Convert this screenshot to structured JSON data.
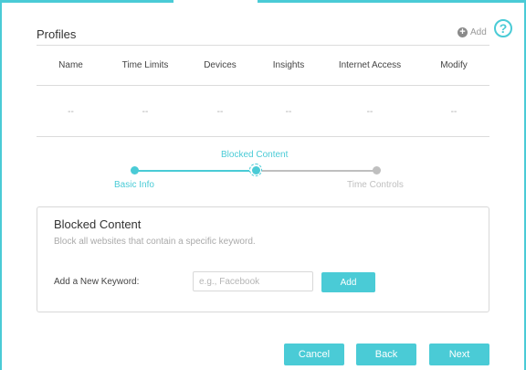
{
  "help": {
    "icon": "help-icon",
    "glyph": "?"
  },
  "profiles": {
    "title": "Profiles",
    "add_label": "Add",
    "add_icon": "plus-circle-icon",
    "columns": [
      "Name",
      "Time Limits",
      "Devices",
      "Insights",
      "Internet Access",
      "Modify"
    ],
    "empty_row": [
      "--",
      "--",
      "--",
      "--",
      "--",
      "--"
    ]
  },
  "stepper": {
    "steps": [
      {
        "label": "Basic Info",
        "status": "completed"
      },
      {
        "label": "Blocked Content",
        "status": "current"
      },
      {
        "label": "Time Controls",
        "status": "upcoming"
      }
    ]
  },
  "blocked_content": {
    "title": "Blocked Content",
    "description": "Block all websites that contain a specific keyword.",
    "keyword_label": "Add a New Keyword:",
    "keyword_value": "",
    "keyword_placeholder": "e.g., Facebook",
    "add_button": "Add"
  },
  "footer": {
    "cancel": "Cancel",
    "back": "Back",
    "next": "Next"
  },
  "colors": {
    "accent": "#4acbd6",
    "inactive": "#bfbfbf",
    "text": "#333333",
    "muted": "#aaaaaa"
  }
}
